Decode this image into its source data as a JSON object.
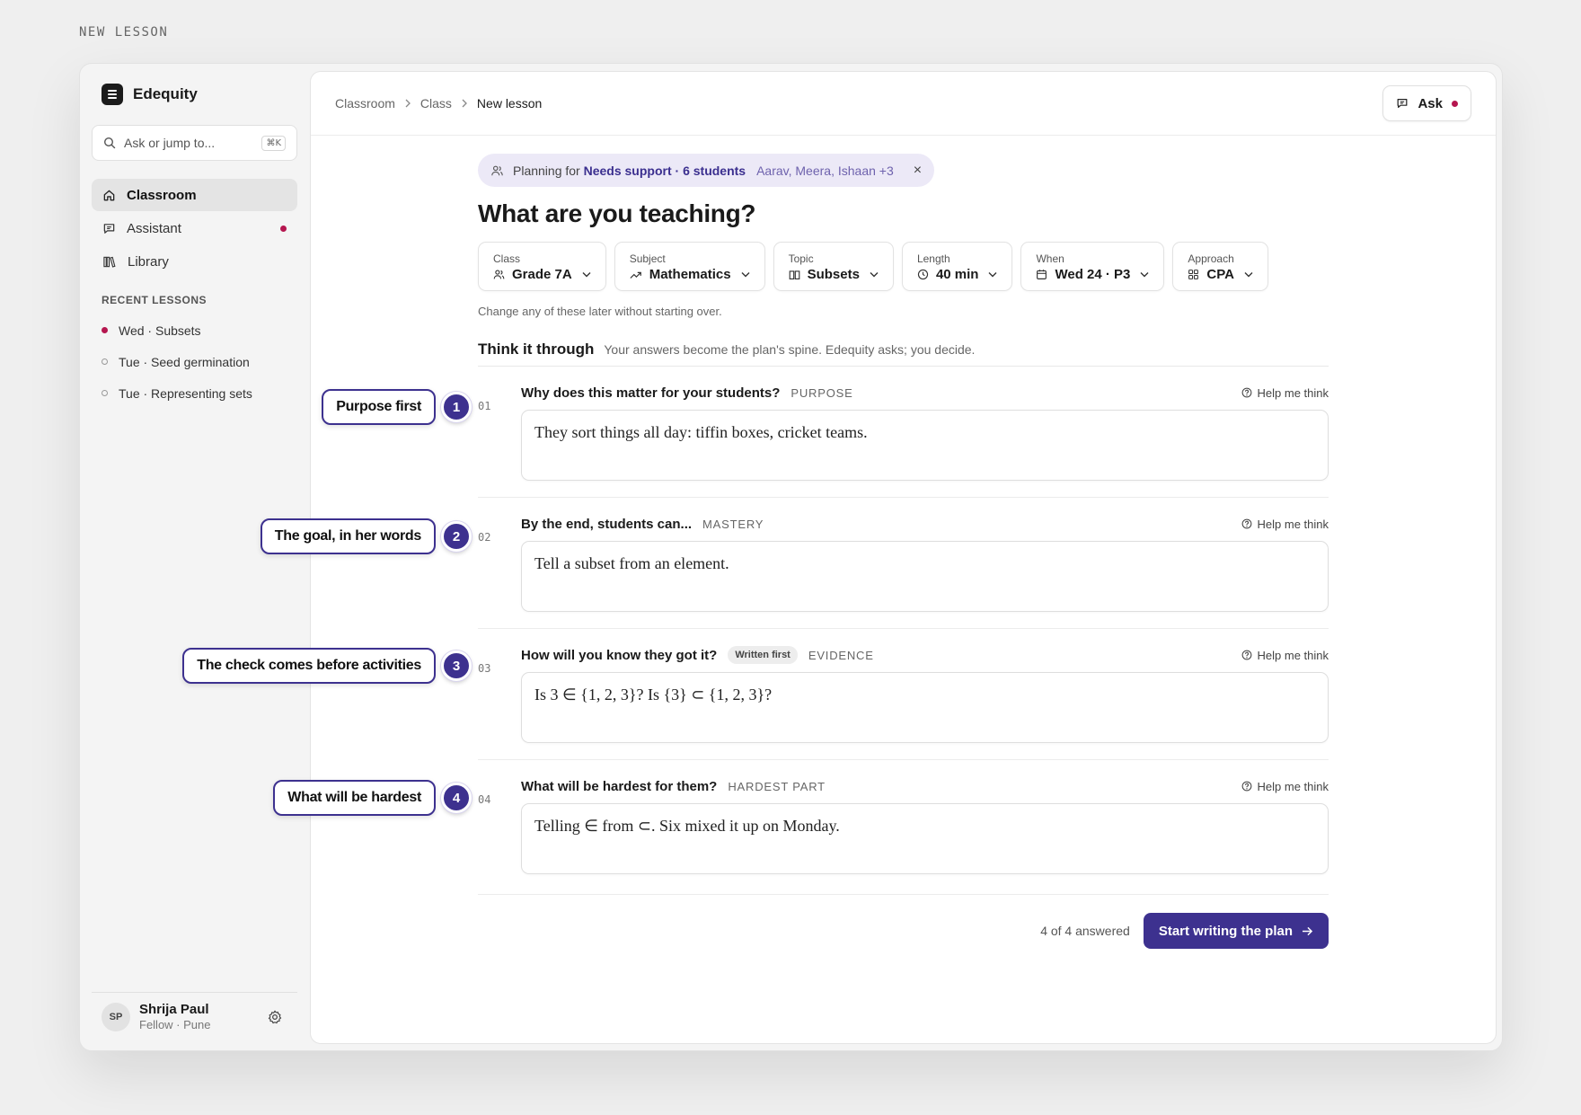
{
  "page_label": "NEW LESSON",
  "brand": {
    "name": "Edequity"
  },
  "search": {
    "placeholder": "Ask or jump to...",
    "shortcut": "⌘K"
  },
  "nav": [
    {
      "label": "Classroom",
      "icon": "home-icon",
      "active": true
    },
    {
      "label": "Assistant",
      "icon": "chat-icon",
      "badge": true
    },
    {
      "label": "Library",
      "icon": "library-icon"
    }
  ],
  "recent": {
    "title": "RECENT LESSONS",
    "items": [
      {
        "label": "Wed · Subsets",
        "active": true
      },
      {
        "label": "Tue · Seed germination"
      },
      {
        "label": "Tue · Representing sets"
      }
    ]
  },
  "user": {
    "initials": "SP",
    "name": "Shrija Paul",
    "subtitle": "Fellow · Pune"
  },
  "breadcrumb": [
    "Classroom",
    "Class",
    "New lesson"
  ],
  "ask": {
    "label": "Ask"
  },
  "planning": {
    "prefix": "Planning for",
    "group": "Needs support · 6 students",
    "names": "Aarav, Meera, Ishaan +3",
    "close": "×"
  },
  "heading": "What are you teaching?",
  "fields": [
    {
      "label": "Class",
      "value": "Grade 7A",
      "icon": "people-icon"
    },
    {
      "label": "Subject",
      "value": "Mathematics",
      "icon": "trend-icon"
    },
    {
      "label": "Topic",
      "value": "Subsets",
      "icon": "book-icon"
    },
    {
      "label": "Length",
      "value": "40 min",
      "icon": "clock-icon"
    },
    {
      "label": "When",
      "value": "Wed 24 · P3",
      "icon": "calendar-icon"
    },
    {
      "label": "Approach",
      "value": "CPA",
      "icon": "grid-icon"
    }
  ],
  "hint": "Change any of these later without starting over.",
  "think": {
    "title": "Think it through",
    "subtitle": "Your answers become the plan's spine. Edequity asks; you decide."
  },
  "help_label": "Help me think",
  "questions": [
    {
      "num": "01",
      "title": "Why does this matter for your students?",
      "tag": "PURPOSE",
      "answer": "They sort things all day: tiffin boxes, cricket teams."
    },
    {
      "num": "02",
      "title": "By the end, students can...",
      "tag": "MASTERY",
      "answer": "Tell a subset from an element."
    },
    {
      "num": "03",
      "title": "How will you know they got it?",
      "pill": "Written first",
      "tag": "EVIDENCE",
      "answer": "Is 3 ∈ {1, 2, 3}? Is {3} ⊂ {1, 2, 3}?"
    },
    {
      "num": "04",
      "title": "What will be hardest for them?",
      "tag": "HARDEST PART",
      "answer": "Telling ∈ from ⊂. Six mixed it up on Monday."
    }
  ],
  "footer": {
    "answered": "4 of 4 answered",
    "cta": "Start writing the plan"
  },
  "callouts": [
    {
      "n": "1",
      "text": "Purpose first"
    },
    {
      "n": "2",
      "text": "The goal, in her words"
    },
    {
      "n": "3",
      "text": "The check comes before activities"
    },
    {
      "n": "4",
      "text": "What will be hardest"
    }
  ],
  "colors": {
    "accent": "#3d318f",
    "badge": "#b5164f",
    "chip_bg": "#ece9f7"
  }
}
